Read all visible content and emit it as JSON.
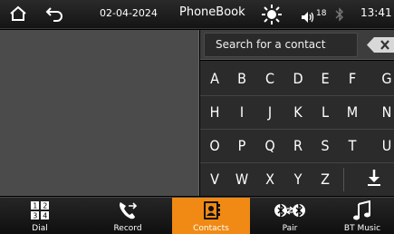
{
  "status": {
    "date": "02-04-2024",
    "title": "PhoneBook",
    "volume": "18",
    "time": "13:41"
  },
  "search": {
    "placeholder": "Search for a contact"
  },
  "keyboard": {
    "rows": [
      [
        "A",
        "B",
        "C",
        "D",
        "E",
        "F",
        "G"
      ],
      [
        "H",
        "I",
        "J",
        "K",
        "L",
        "M",
        "N"
      ],
      [
        "O",
        "P",
        "Q",
        "R",
        "S",
        "T",
        "U"
      ],
      [
        "V",
        "W",
        "X",
        "Y",
        "Z"
      ]
    ]
  },
  "nav": {
    "items": [
      {
        "label": "Dial",
        "icon": "dialpad-icon"
      },
      {
        "label": "Record",
        "icon": "call-history-icon"
      },
      {
        "label": "Contacts",
        "icon": "contacts-icon",
        "active": true
      },
      {
        "label": "Pair",
        "icon": "bluetooth-pair-icon"
      },
      {
        "label": "BT Music",
        "icon": "music-note-icon"
      }
    ]
  },
  "colors": {
    "accent": "#f08a14"
  }
}
